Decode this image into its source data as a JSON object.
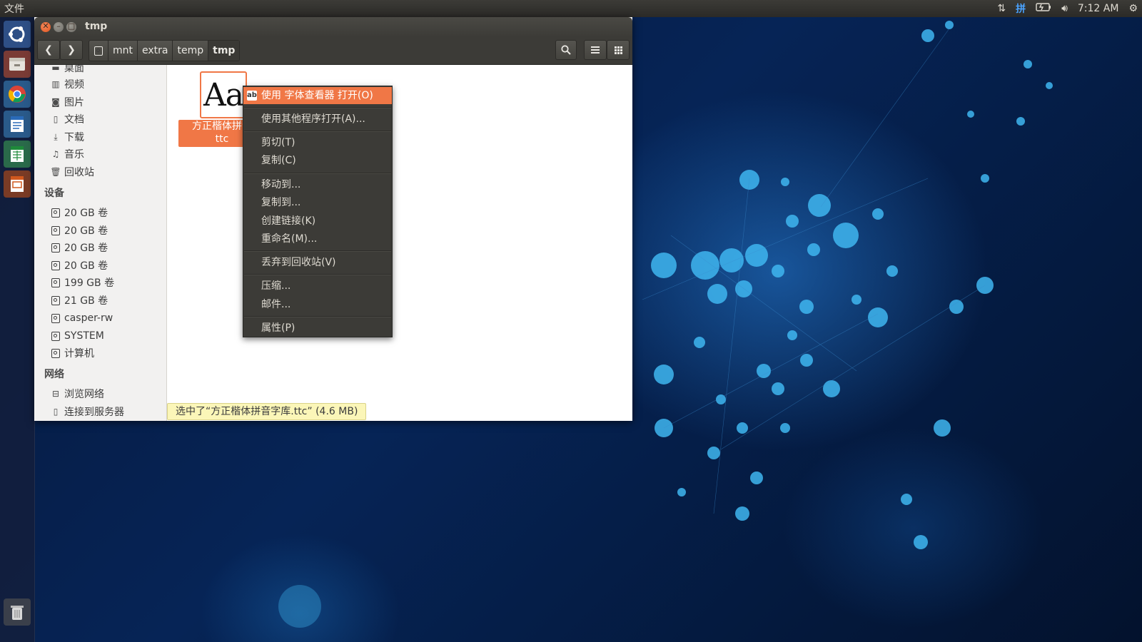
{
  "top_panel": {
    "app_menu": "文件",
    "input_method": "拼",
    "time": "7:12 AM"
  },
  "launcher": {
    "items": [
      "ubuntu-logo",
      "files-icon",
      "chrome-icon",
      "writer-icon",
      "calc-icon",
      "impress-icon",
      "trash-icon"
    ]
  },
  "window": {
    "title": "tmp",
    "breadcrumbs": [
      "mnt",
      "extra",
      "temp",
      "tmp"
    ]
  },
  "sidebar": {
    "places": [
      {
        "label": "桌面",
        "icon": "desktop-icon"
      },
      {
        "label": "视频",
        "icon": "video-icon"
      },
      {
        "label": "图片",
        "icon": "camera-icon"
      },
      {
        "label": "文档",
        "icon": "document-icon"
      },
      {
        "label": "下载",
        "icon": "download-icon"
      },
      {
        "label": "音乐",
        "icon": "music-icon"
      },
      {
        "label": "回收站",
        "icon": "trash-icon"
      }
    ],
    "devices_heading": "设备",
    "devices": [
      "20 GB 卷",
      "20 GB 卷",
      "20 GB 卷",
      "20 GB 卷",
      "199 GB 卷",
      "21 GB 卷",
      "casper-rw",
      "SYSTEM",
      "计算机"
    ],
    "network_heading": "网络",
    "network": [
      {
        "label": "浏览网络",
        "icon": "network-icon"
      },
      {
        "label": "连接到服务器",
        "icon": "server-icon"
      }
    ]
  },
  "file": {
    "preview": "Aa",
    "name_line1": "方正楷体拼音",
    "name_line2": "ttc"
  },
  "status": "选中了“方正楷体拼音字库.ttc” (4.6 MB)",
  "context_menu": {
    "items": [
      "使用 字体查看器 打开(O)",
      "使用其他程序打开(A)...",
      "剪切(T)",
      "复制(C)",
      "移动到...",
      "复制到...",
      "创建链接(K)",
      "重命名(M)...",
      "丢弃到回收站(V)",
      "压缩...",
      "邮件...",
      "属性(P)"
    ],
    "highlight_color": "#f07746"
  }
}
